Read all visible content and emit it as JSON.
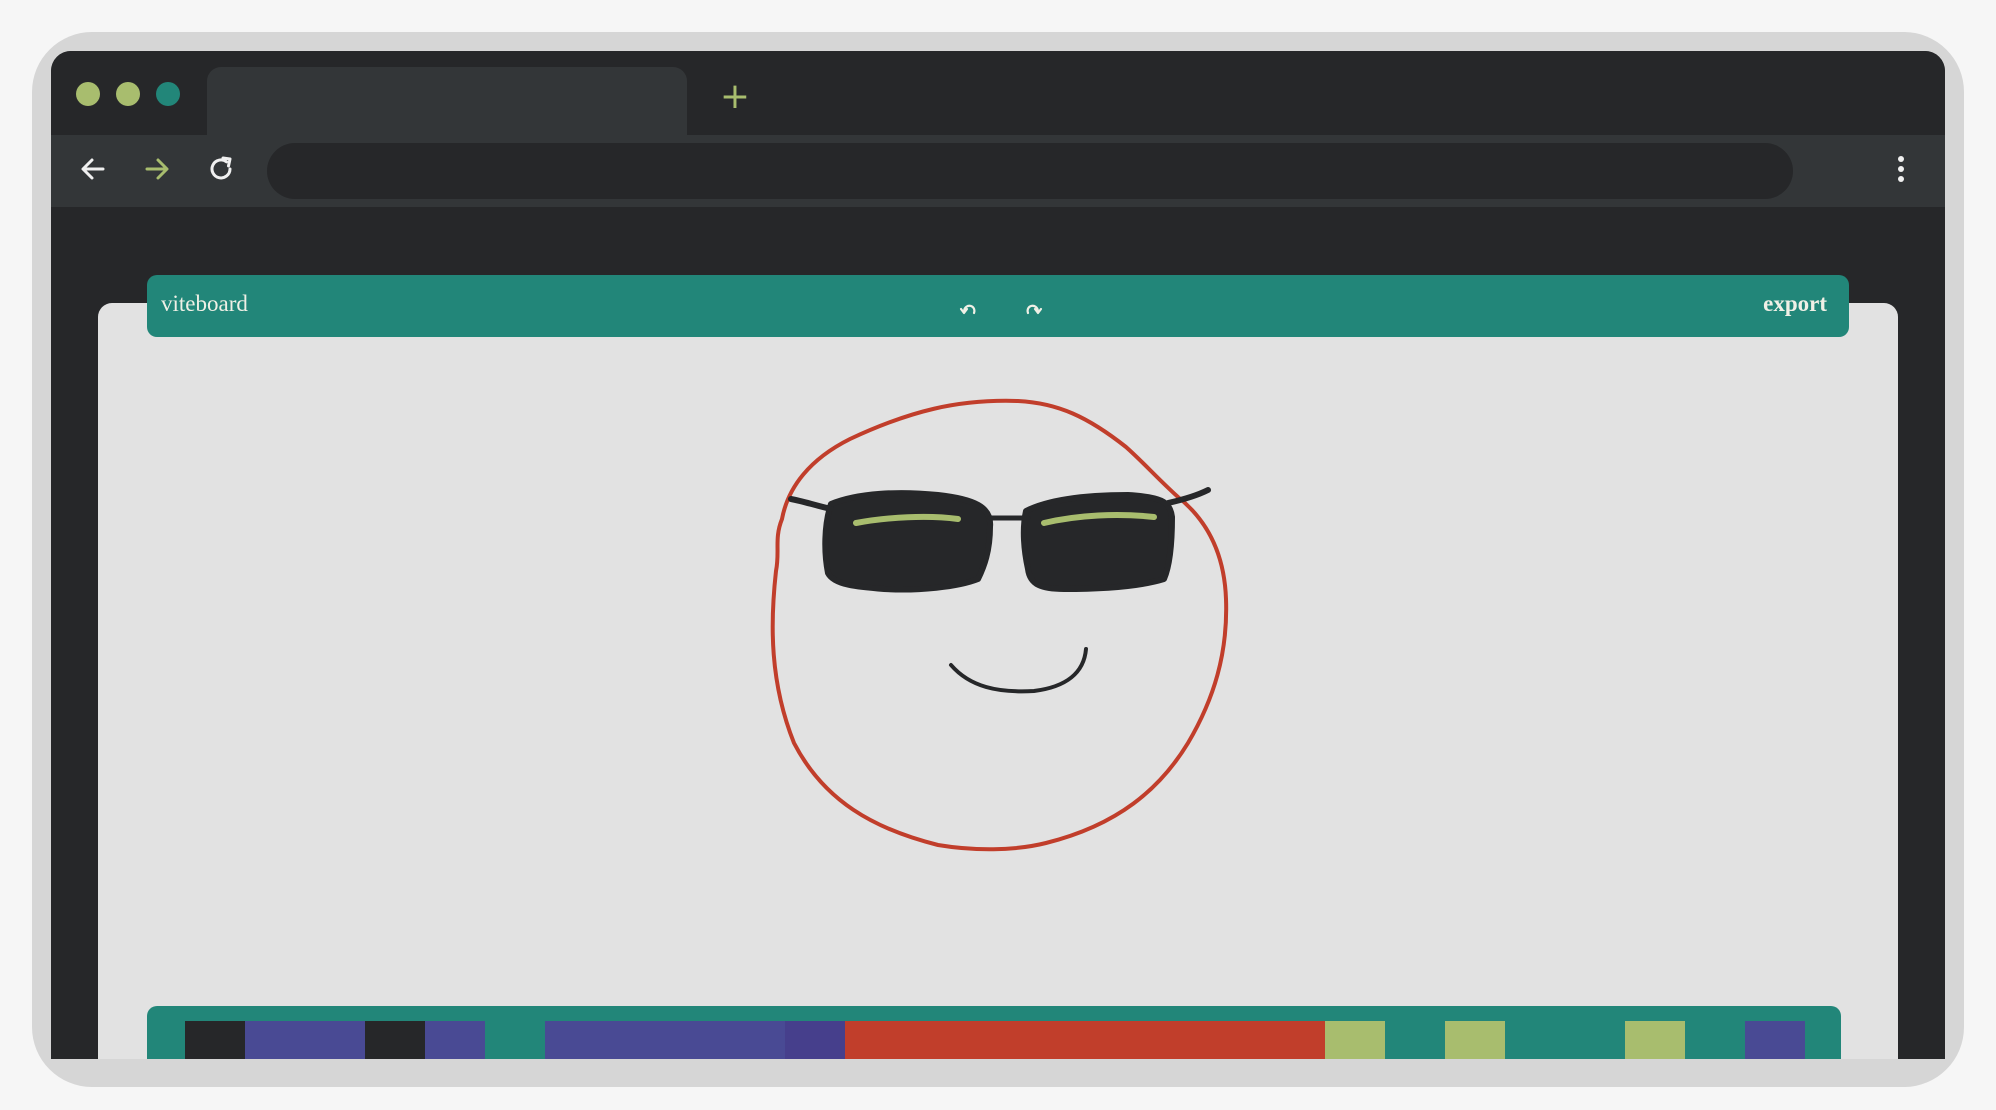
{
  "browser": {
    "window_dots": [
      {
        "name": "minimize-dot",
        "color": "#a8bd6e"
      },
      {
        "name": "maximize-dot",
        "color": "#a8bd6e"
      },
      {
        "name": "close-dot",
        "color": "#228679"
      }
    ],
    "new_tab_glyph": "+",
    "nav_icons": [
      "back-arrow-icon",
      "forward-arrow-icon",
      "reload-icon"
    ],
    "menu_icon": "more-vert-icon",
    "url": ""
  },
  "app": {
    "brand": "viteboard",
    "undo_icon": "undo-icon",
    "redo_icon": "redo-icon",
    "export_label": "export"
  },
  "palette": {
    "colors": [
      "#262729",
      "#494a94",
      "#494a94",
      "#262729",
      "#494a94",
      "#228679",
      "#494a94",
      "#494a94",
      "#494a94",
      "#494a94",
      "#463f8c",
      "#c13e2b",
      "#c13e2b",
      "#c13e2b",
      "#c13e2b",
      "#c13e2b",
      "#c13e2b",
      "#c13e2b",
      "#c13e2b",
      "#a8bd6e",
      "#228679",
      "#a8bd6e",
      "#228679",
      "#228679",
      "#a8bd6e",
      "#228679",
      "#494a94"
    ]
  },
  "theme": {
    "accent": "#228679",
    "dark": "#262729",
    "board": "#e2e2e2",
    "stroke_face": "#c13e2b",
    "stroke_dark": "#262729",
    "stroke_highlight": "#a8bd6e"
  }
}
